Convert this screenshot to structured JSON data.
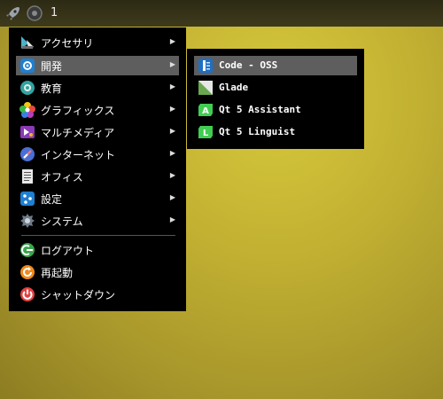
{
  "panel": {
    "workspace": "1"
  },
  "main_menu": {
    "items": [
      {
        "label": "アクセサリ",
        "icon": "accessories-icon"
      },
      {
        "label": "開発",
        "icon": "development-gear-icon"
      },
      {
        "label": "教育",
        "icon": "education-icon"
      },
      {
        "label": "グラフィックス",
        "icon": "graphics-flower-icon"
      },
      {
        "label": "マルチメディア",
        "icon": "multimedia-icon"
      },
      {
        "label": "インターネット",
        "icon": "internet-icon"
      },
      {
        "label": "オフィス",
        "icon": "office-document-icon"
      },
      {
        "label": "設定",
        "icon": "settings-icon"
      },
      {
        "label": "システム",
        "icon": "system-gear-icon"
      }
    ],
    "session": [
      {
        "label": "ログアウト",
        "icon": "logout-icon"
      },
      {
        "label": "再起動",
        "icon": "restart-icon"
      },
      {
        "label": "シャットダウン",
        "icon": "shutdown-icon"
      }
    ],
    "arrow": "▶"
  },
  "sub_menu": {
    "items": [
      {
        "label": "Code - OSS",
        "icon": "code-oss-icon"
      },
      {
        "label": "Glade",
        "icon": "glade-icon"
      },
      {
        "label": "Qt 5 Assistant",
        "icon": "qt-assistant-icon",
        "badge": "A"
      },
      {
        "label": "Qt 5 Linguist",
        "icon": "qt-linguist-icon",
        "badge": "L"
      }
    ]
  },
  "colors": {
    "highlight": "#5e5e5e",
    "menu_bg": "#000000",
    "desktop": "#c3b232"
  }
}
